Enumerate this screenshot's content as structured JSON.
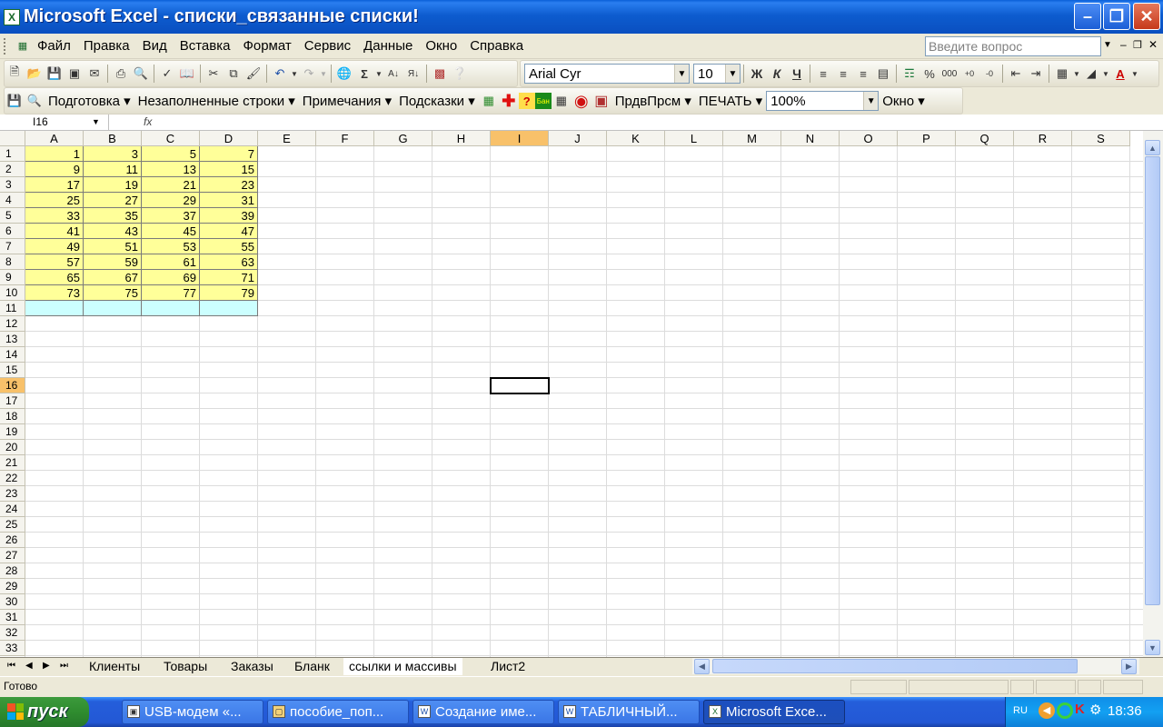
{
  "window": {
    "title": "Microsoft Excel - списки_связанные списки!",
    "app_icon": "X"
  },
  "menu": {
    "items": [
      "Файл",
      "Правка",
      "Вид",
      "Вставка",
      "Формат",
      "Сервис",
      "Данные",
      "Окно",
      "Справка"
    ],
    "ask_placeholder": "Введите вопрос"
  },
  "format": {
    "font": "Arial Cyr",
    "size": "10",
    "bold": "Ж",
    "italic": "К",
    "underline": "Ч",
    "percent": "%",
    "thousands": "000"
  },
  "custom_toolbar": {
    "items": [
      "Подготовка",
      "Незаполненные строки",
      "Примечания",
      "Подсказки"
    ],
    "prdv": "ПрдвПрсм",
    "print": "ПЕЧАТЬ",
    "zoom": "100%",
    "window": "Окно"
  },
  "formula": {
    "name_box": "I16",
    "fx": "fx"
  },
  "columns": [
    "A",
    "B",
    "C",
    "D",
    "E",
    "F",
    "G",
    "H",
    "I",
    "J",
    "K",
    "L",
    "M",
    "N",
    "O",
    "P",
    "Q",
    "R",
    "S"
  ],
  "selected_column": "I",
  "rows": [
    "1",
    "2",
    "3",
    "4",
    "5",
    "6",
    "7",
    "8",
    "9",
    "10",
    "11",
    "12",
    "13",
    "14",
    "15",
    "16",
    "17",
    "18",
    "19",
    "20",
    "21",
    "22",
    "23",
    "24",
    "25",
    "26",
    "27",
    "28",
    "29",
    "30",
    "31",
    "32",
    "33"
  ],
  "selected_row": "16",
  "cells": [
    [
      "1",
      "3",
      "5",
      "7"
    ],
    [
      "9",
      "11",
      "13",
      "15"
    ],
    [
      "17",
      "19",
      "21",
      "23"
    ],
    [
      "25",
      "27",
      "29",
      "31"
    ],
    [
      "33",
      "35",
      "37",
      "39"
    ],
    [
      "41",
      "43",
      "45",
      "47"
    ],
    [
      "49",
      "51",
      "53",
      "55"
    ],
    [
      "57",
      "59",
      "61",
      "63"
    ],
    [
      "65",
      "67",
      "69",
      "71"
    ],
    [
      "73",
      "75",
      "77",
      "79"
    ]
  ],
  "colors": {
    "data_fill": "#ffff99",
    "row11_fill": "#ccffff",
    "selected_header": "#f8c16a"
  },
  "sheets": [
    "Клиенты",
    "Товары",
    "Заказы",
    "Бланк",
    "ссылки и массивы",
    "Лист2"
  ],
  "active_sheet": "ссылки и массивы",
  "status": "Готово",
  "taskbar": {
    "start": "пуск",
    "tasks": [
      "USB-модем «...",
      "пособие_поп...",
      "Создание име...",
      "ТАБЛИЧНЫЙ...",
      "Microsoft Exce..."
    ],
    "lang": "RU",
    "clock": "18:36"
  }
}
